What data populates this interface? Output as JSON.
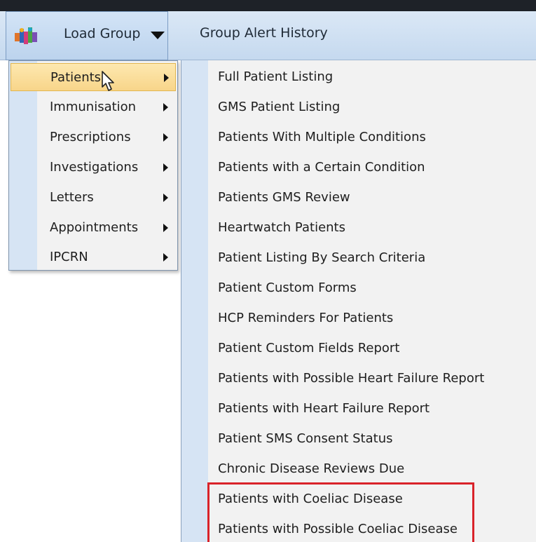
{
  "toolbar": {
    "load_group_label": "Load Group",
    "group_alert_history_label": "Group Alert History"
  },
  "menu1": {
    "items": [
      {
        "label": "Patients",
        "selected": true
      },
      {
        "label": "Immunisation"
      },
      {
        "label": "Prescriptions"
      },
      {
        "label": "Investigations"
      },
      {
        "label": "Letters"
      },
      {
        "label": "Appointments"
      },
      {
        "label": "IPCRN"
      }
    ]
  },
  "menu2": {
    "items": [
      {
        "label": "Full Patient Listing"
      },
      {
        "label": "GMS Patient Listing"
      },
      {
        "label": "Patients With Multiple Conditions"
      },
      {
        "label": "Patients with a Certain Condition"
      },
      {
        "label": "Patients GMS Review"
      },
      {
        "label": "Heartwatch Patients"
      },
      {
        "label": "Patient Listing By Search Criteria"
      },
      {
        "label": "Patient Custom Forms"
      },
      {
        "label": "HCP Reminders For Patients"
      },
      {
        "label": "Patient Custom Fields Report"
      },
      {
        "label": "Patients with Possible Heart Failure Report"
      },
      {
        "label": "Patients with Heart Failure Report"
      },
      {
        "label": "Patient SMS Consent Status"
      },
      {
        "label": "Chronic Disease Reviews Due"
      },
      {
        "label": "Patients with Coeliac Disease"
      },
      {
        "label": "Patients with Possible Coeliac Disease"
      }
    ]
  },
  "colors": {
    "highlight_box": "#d9232a",
    "selected_item": "#f8d58a",
    "toolbar": "#c5d9ef"
  }
}
